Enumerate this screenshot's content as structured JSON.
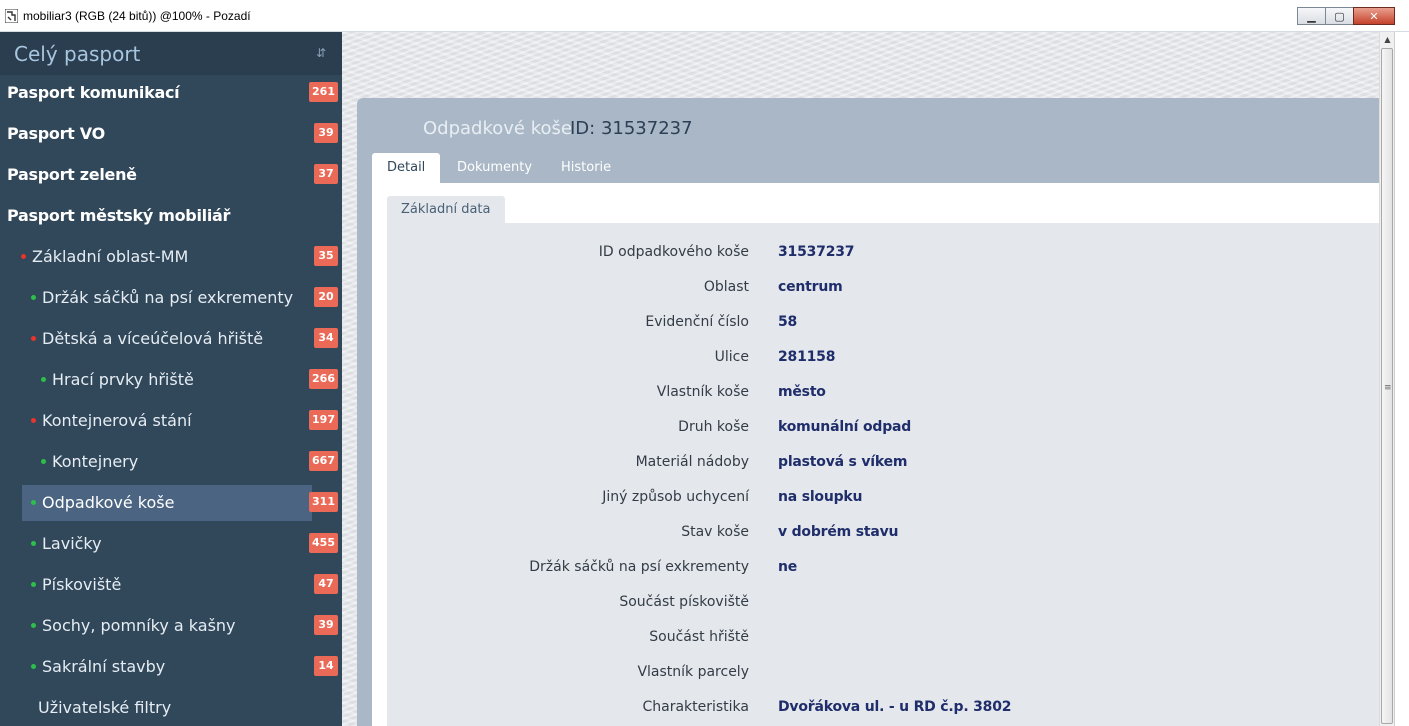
{
  "window": {
    "title": "mobiliar3 (RGB (24 bitů)) @100% - Pozadí",
    "minimize_symbol": "▁",
    "maximize_symbol": "▢",
    "close_symbol": "✕"
  },
  "sidebar": {
    "title": "Celý pasport",
    "pin_symbol": "⇵",
    "items": [
      {
        "label": "Pasport komunikací",
        "badge": "261"
      },
      {
        "label": "Pasport VO",
        "badge": "39"
      },
      {
        "label": "Pasport zeleně",
        "badge": "37"
      },
      {
        "label": "Pasport městský mobiliář",
        "badge": ""
      },
      {
        "label": "Základní oblast-MM",
        "badge": "35"
      },
      {
        "label": "Držák sáčků na psí exkrementy",
        "badge": "20"
      },
      {
        "label": "Dětská a víceúčelová hřiště",
        "badge": "34"
      },
      {
        "label": "Hrací prvky hřiště",
        "badge": "266"
      },
      {
        "label": "Kontejnerová stání",
        "badge": "197"
      },
      {
        "label": "Kontejnery",
        "badge": "667"
      },
      {
        "label": "Odpadkové koše",
        "badge": "311"
      },
      {
        "label": "Lavičky",
        "badge": "455"
      },
      {
        "label": "Pískoviště",
        "badge": "47"
      },
      {
        "label": "Sochy, pomníky a kašny",
        "badge": "39"
      },
      {
        "label": "Sakrální stavby",
        "badge": "14"
      },
      {
        "label": "Uživatelské filtry",
        "badge": ""
      }
    ]
  },
  "detail": {
    "title": "Odpadkové koše",
    "id_text": "ID: 31537237",
    "tabs": [
      "Detail",
      "Dokumenty",
      "Historie"
    ],
    "active_tab": "Detail",
    "section_label": "Základní data",
    "fields": [
      {
        "label": "ID odpadkového koše",
        "value": "31537237"
      },
      {
        "label": "Oblast",
        "value": "centrum"
      },
      {
        "label": "Evidenční číslo",
        "value": "58"
      },
      {
        "label": "Ulice",
        "value": "281158"
      },
      {
        "label": "Vlastník koše",
        "value": "město"
      },
      {
        "label": "Druh koše",
        "value": "komunální odpad"
      },
      {
        "label": "Materiál nádoby",
        "value": "plastová s víkem"
      },
      {
        "label": "Jiný způsob uchycení",
        "value": "na sloupku"
      },
      {
        "label": "Stav koše",
        "value": "v dobrém stavu"
      },
      {
        "label": "Držák sáčků na psí exkrementy",
        "value": "ne"
      },
      {
        "label": "Součást pískoviště",
        "value": ""
      },
      {
        "label": "Součást hřiště",
        "value": ""
      },
      {
        "label": "Vlastník parcely",
        "value": ""
      },
      {
        "label": "Charakteristika",
        "value": "Dvořákova ul. - u RD č.p. 3802"
      }
    ]
  },
  "scrollbar": {
    "up_symbol": "▲",
    "grip_symbol": "≡"
  },
  "colors": {
    "sidebar_bg": "#31475a",
    "sidebar_header_bg": "#2a3e50",
    "selected_item_bg": "#4a6482",
    "badge_bg": "#ea6a57",
    "dot_red": "#e8352b",
    "dot_green": "#2cc04a",
    "panel_header_bg": "#a9b7c6",
    "value_text": "#1f2d6b"
  }
}
